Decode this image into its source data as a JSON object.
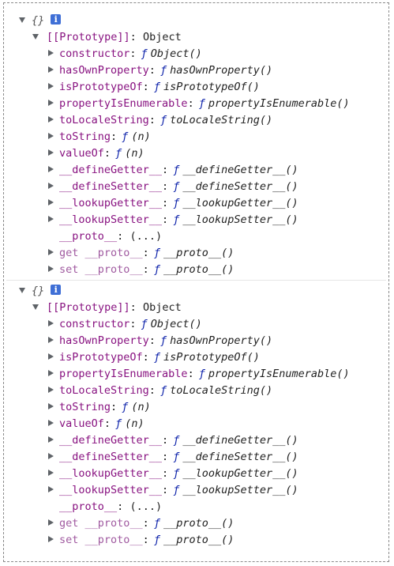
{
  "blocks": [
    {
      "header": "{}",
      "prototype_label": "[[Prototype]]",
      "prototype_value": "Object",
      "entries": [
        {
          "key": "constructor",
          "type": "ƒ",
          "sig": "Object()",
          "expandable": true
        },
        {
          "key": "hasOwnProperty",
          "type": "ƒ",
          "sig": "hasOwnProperty()",
          "expandable": true
        },
        {
          "key": "isPrototypeOf",
          "type": "ƒ",
          "sig": "isPrototypeOf()",
          "expandable": true
        },
        {
          "key": "propertyIsEnumerable",
          "type": "ƒ",
          "sig": "propertyIsEnumerable()",
          "expandable": true
        },
        {
          "key": "toLocaleString",
          "type": "ƒ",
          "sig": "toLocaleString()",
          "expandable": true
        },
        {
          "key": "toString",
          "type": "ƒ",
          "sig": "(n)",
          "expandable": true
        },
        {
          "key": "valueOf",
          "type": "ƒ",
          "sig": "(n)",
          "expandable": true
        },
        {
          "key": "__defineGetter__",
          "type": "ƒ",
          "sig": "__defineGetter__()",
          "expandable": true
        },
        {
          "key": "__defineSetter__",
          "type": "ƒ",
          "sig": "__defineSetter__()",
          "expandable": true
        },
        {
          "key": "__lookupGetter__",
          "type": "ƒ",
          "sig": "__lookupGetter__()",
          "expandable": true
        },
        {
          "key": "__lookupSetter__",
          "type": "ƒ",
          "sig": "__lookupSetter__()",
          "expandable": true
        },
        {
          "key": "__proto__",
          "type": "",
          "sig": "(...)",
          "expandable": false
        },
        {
          "key": "get __proto__",
          "type": "ƒ",
          "sig": "__proto__()",
          "expandable": true
        },
        {
          "key": "set __proto__",
          "type": "ƒ",
          "sig": "__proto__()",
          "expandable": true
        }
      ]
    },
    {
      "header": "{}",
      "prototype_label": "[[Prototype]]",
      "prototype_value": "Object",
      "entries": [
        {
          "key": "constructor",
          "type": "ƒ",
          "sig": "Object()",
          "expandable": true
        },
        {
          "key": "hasOwnProperty",
          "type": "ƒ",
          "sig": "hasOwnProperty()",
          "expandable": true
        },
        {
          "key": "isPrototypeOf",
          "type": "ƒ",
          "sig": "isPrototypeOf()",
          "expandable": true
        },
        {
          "key": "propertyIsEnumerable",
          "type": "ƒ",
          "sig": "propertyIsEnumerable()",
          "expandable": true
        },
        {
          "key": "toLocaleString",
          "type": "ƒ",
          "sig": "toLocaleString()",
          "expandable": true
        },
        {
          "key": "toString",
          "type": "ƒ",
          "sig": "(n)",
          "expandable": true
        },
        {
          "key": "valueOf",
          "type": "ƒ",
          "sig": "(n)",
          "expandable": true
        },
        {
          "key": "__defineGetter__",
          "type": "ƒ",
          "sig": "__defineGetter__()",
          "expandable": true
        },
        {
          "key": "__defineSetter__",
          "type": "ƒ",
          "sig": "__defineSetter__()",
          "expandable": true
        },
        {
          "key": "__lookupGetter__",
          "type": "ƒ",
          "sig": "__lookupGetter__()",
          "expandable": true
        },
        {
          "key": "__lookupSetter__",
          "type": "ƒ",
          "sig": "__lookupSetter__()",
          "expandable": true
        },
        {
          "key": "__proto__",
          "type": "",
          "sig": "(...)",
          "expandable": false
        },
        {
          "key": "get __proto__",
          "type": "ƒ",
          "sig": "__proto__()",
          "expandable": true
        },
        {
          "key": "set __proto__",
          "type": "ƒ",
          "sig": "__proto__()",
          "expandable": true
        }
      ]
    }
  ],
  "info_icon": {
    "glyph": "i",
    "icon": "info-icon"
  }
}
